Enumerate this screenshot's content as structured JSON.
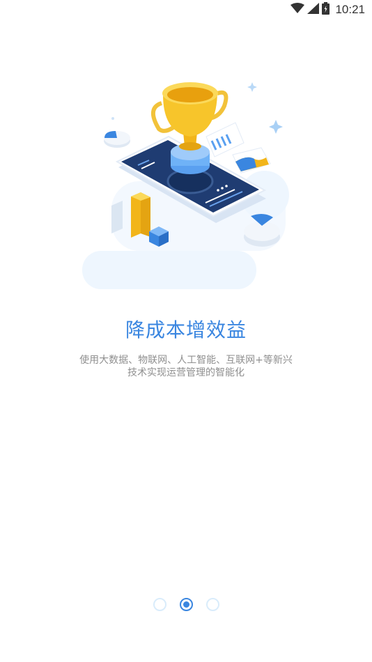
{
  "status_bar": {
    "time": "10:21",
    "icons": [
      "wifi-icon",
      "cellular-signal-icon",
      "battery-icon"
    ]
  },
  "onboarding": {
    "title": "降成本增效益",
    "description_line1": "使用大数据、物联网、人工智能、互联网+等新兴",
    "description_line2": "技术实现运营管理的智能化",
    "illustration": "trophy-on-phone-illustration"
  },
  "pager": {
    "total_pages": 3,
    "current_page": 2
  },
  "colors": {
    "accent": "#3a86e0",
    "subtext": "#8f8f8f",
    "dot_inactive": "#d9ecfb",
    "phone": "#1f3c72",
    "trophy": "#f2b51a"
  }
}
